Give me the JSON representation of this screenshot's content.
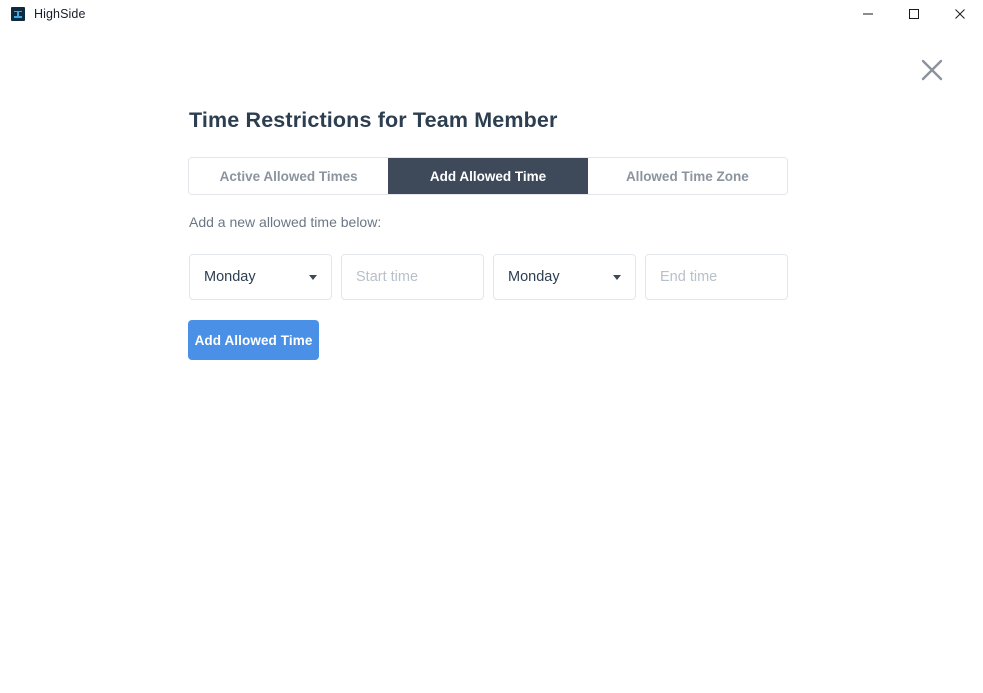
{
  "window": {
    "app_name": "HighSide",
    "app_icon": "highside-logo-icon",
    "controls": {
      "minimize": "minimize-icon",
      "maximize": "maximize-icon",
      "close": "close-icon"
    }
  },
  "panel": {
    "close_icon": "close-x-icon",
    "title": "Time Restrictions for Team Member",
    "tabs": [
      {
        "label": "Active Allowed Times",
        "active": false
      },
      {
        "label": "Add Allowed Time",
        "active": true
      },
      {
        "label": "Allowed Time Zone",
        "active": false
      }
    ],
    "instruction": "Add a new allowed time below:",
    "form": {
      "start_day": {
        "value": "Monday",
        "caret_icon": "chevron-down-icon"
      },
      "start_time": {
        "value": "",
        "placeholder": "Start time"
      },
      "end_day": {
        "value": "Monday",
        "caret_icon": "chevron-down-icon"
      },
      "end_time": {
        "value": "",
        "placeholder": "End time"
      }
    },
    "submit_label": "Add Allowed Time"
  },
  "colors": {
    "accent_blue": "#4a90e6",
    "tab_active_bg": "#3e4a5a",
    "title_text": "#2c3e50",
    "muted_text": "#6b7785",
    "placeholder_text": "#b8c0c9",
    "border": "#e3e6ea",
    "app_icon_bg": "#0d2a42",
    "app_icon_glyph": "#3aa9e0"
  }
}
